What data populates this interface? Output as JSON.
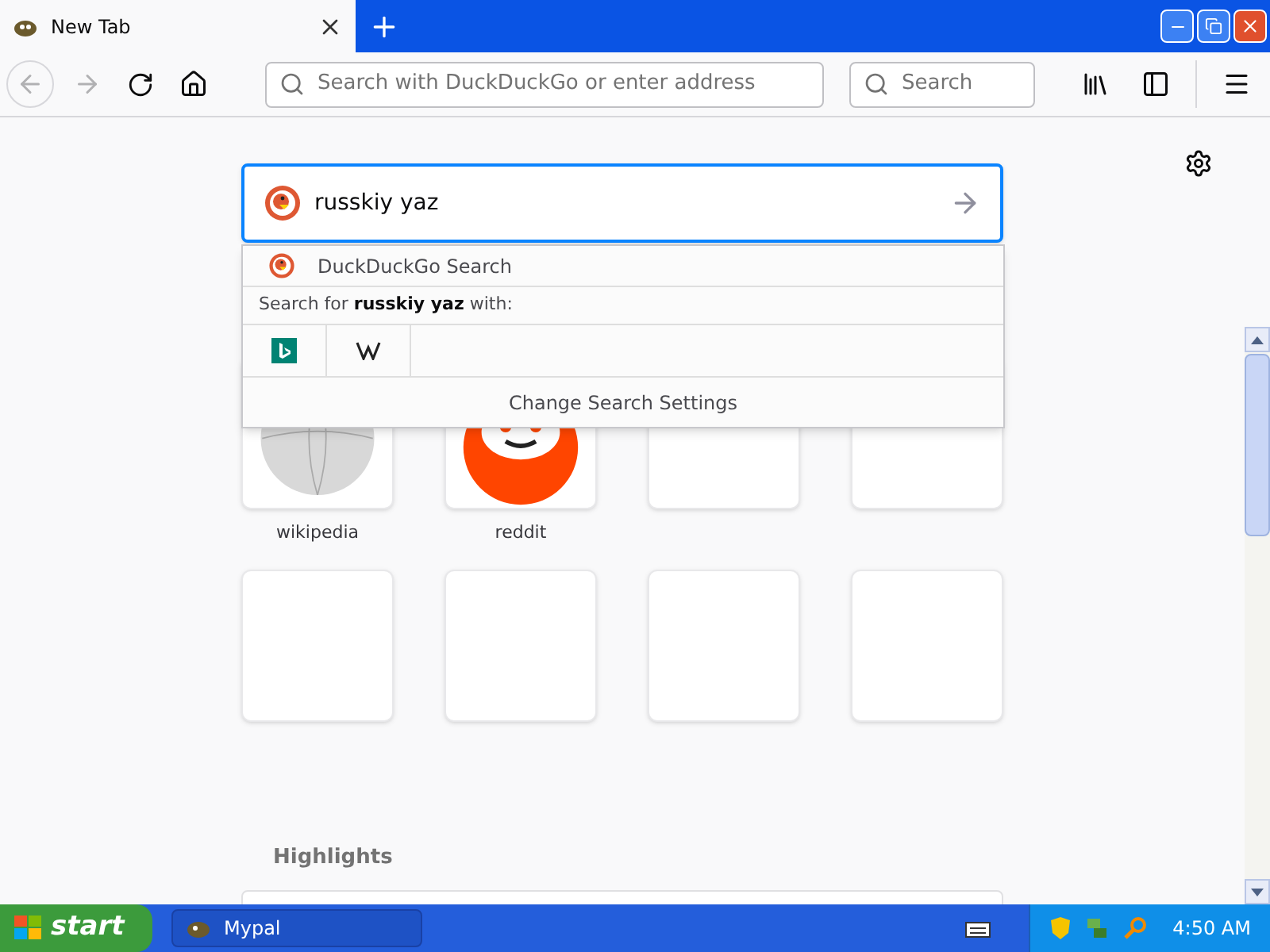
{
  "tab": {
    "title": "New Tab"
  },
  "toolbar": {
    "address_placeholder": "Search with DuckDuckGo or enter address",
    "search_placeholder": "Search"
  },
  "search_box": {
    "value": "russkiy yaz"
  },
  "dropdown": {
    "engine_label": "DuckDuckGo Search",
    "search_for_prefix": "Search for ",
    "search_for_term": "russkiy yaz",
    "search_for_suffix": " with:",
    "settings_label": "Change Search Settings"
  },
  "top_sites": [
    {
      "kind": "wikipedia",
      "label": "wikipedia"
    },
    {
      "kind": "reddit",
      "label": "reddit"
    },
    {
      "kind": "empty"
    },
    {
      "kind": "empty"
    },
    {
      "kind": "empty"
    },
    {
      "kind": "empty"
    },
    {
      "kind": "empty"
    },
    {
      "kind": "empty"
    }
  ],
  "highlights": {
    "title": "Highlights"
  },
  "taskbar": {
    "start_label": "start",
    "task_label": "Mypal",
    "clock": "4:50 AM"
  }
}
